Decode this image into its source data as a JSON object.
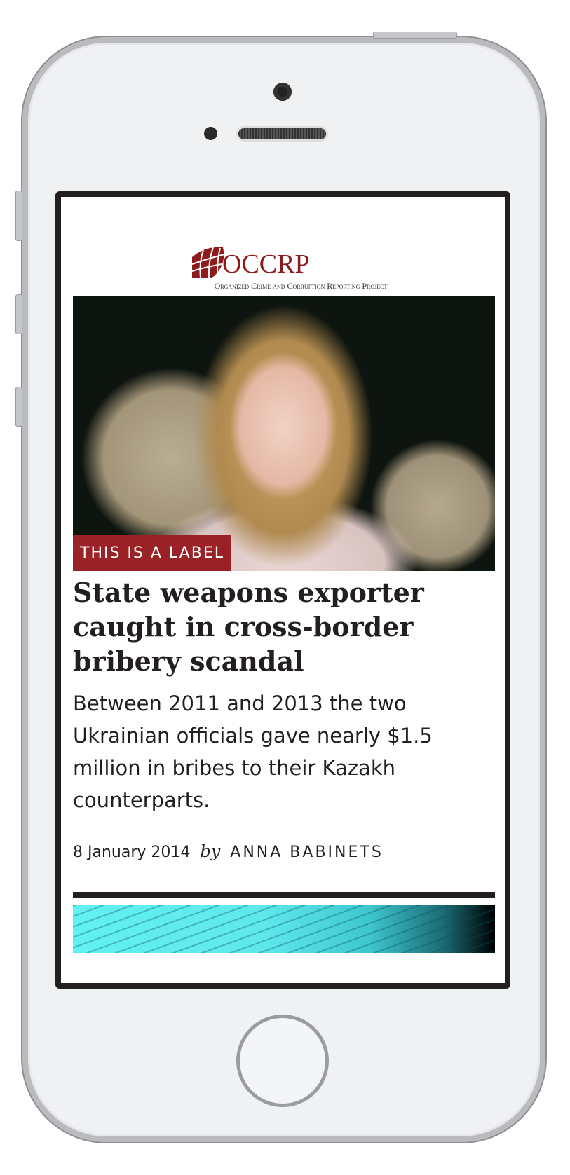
{
  "logo": {
    "name": "OCCRP",
    "tagline": "Organized Crime and Corruption Reporting Project"
  },
  "article": {
    "label": "THIS IS A LABEL",
    "headline": "State weapons exporter caught in cross-border bribery scandal",
    "summary": "Between 2011 and 2013 the two Ukrainian officials gave nearly $1.5 million in bribes to their Kazakh counterparts.",
    "date": "8 January 2014",
    "by": "by",
    "author": "ANNA BABINETS"
  },
  "colors": {
    "brand": "#8e1b1b",
    "label_bg": "#9a2227",
    "text": "#231f20"
  }
}
